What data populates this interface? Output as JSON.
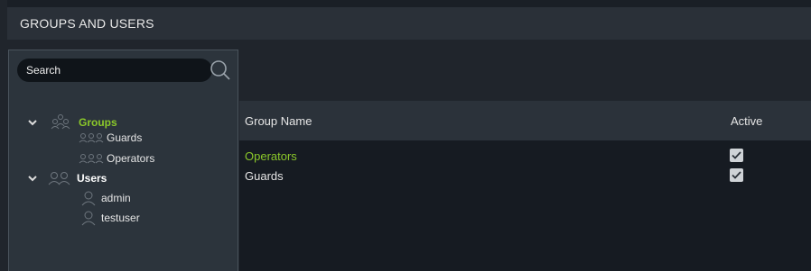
{
  "window": {
    "title": "GROUPS AND USERS"
  },
  "search": {
    "placeholder": "Search"
  },
  "tree": {
    "groups_label": "Groups",
    "group_items": [
      "Guards",
      "Operators"
    ],
    "users_label": "Users",
    "user_items": [
      "admin",
      "testuser"
    ]
  },
  "grid": {
    "columns": {
      "name": "Group Name",
      "active": "Active"
    },
    "rows": [
      {
        "name": "Operators",
        "active": true,
        "color": "#8bc82a"
      },
      {
        "name": "Guards",
        "active": true,
        "color": "#e6e6e6"
      }
    ]
  },
  "colors": {
    "accent": "#8bc82a"
  }
}
